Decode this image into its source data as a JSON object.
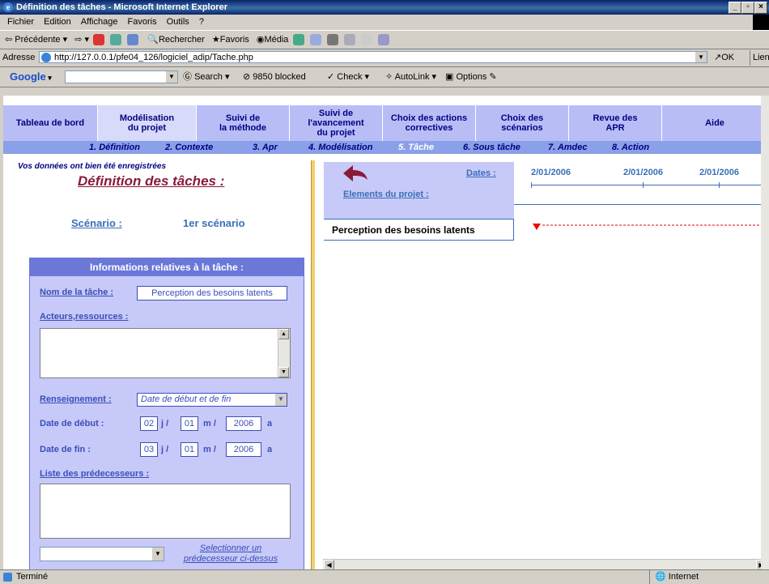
{
  "window": {
    "title": "Définition des tâches - Microsoft Internet Explorer"
  },
  "menu": [
    "Fichier",
    "Edition",
    "Affichage",
    "Favoris",
    "Outils",
    "?"
  ],
  "toolbar": {
    "back": "Précédente",
    "search": "Rechercher",
    "favorites": "Favoris",
    "media": "Média"
  },
  "address": {
    "label": "Adresse",
    "url": "http://127.0.0.1/pfe04_126/logiciel_adip/Tache.php",
    "go": "OK",
    "links": "Lien"
  },
  "google": {
    "logo": "Google",
    "search": "Search",
    "blocked": "9850 blocked",
    "check": "Check",
    "autolink": "AutoLink",
    "options": "Options"
  },
  "tabs": [
    {
      "label": "Tableau de bord"
    },
    {
      "label": "Modélisation\ndu projet"
    },
    {
      "label": "Suivi de\nla méthode"
    },
    {
      "label": "Suivi de\nl'avancement\ndu projet"
    },
    {
      "label": "Choix des actions\ncorrectives"
    },
    {
      "label": "Choix des\nscénarios"
    },
    {
      "label": "Revue des\nAPR"
    },
    {
      "label": "Aide"
    }
  ],
  "subnav": [
    "1. Définition",
    "2. Contexte",
    "3. Apr",
    "4. Modélisation",
    "5. Tâche",
    "6. Sous tâche",
    "7. Amdec",
    "8. Action"
  ],
  "saved_msg": "Vos données ont bien été enregistrées",
  "page_title": "Définition des tâches :",
  "scenario": {
    "label": "Scénario :",
    "value": "1er scénario"
  },
  "panel": {
    "header": "Informations relatives à la tâche :",
    "task_name_label": "Nom de la tâche :",
    "task_name_value": "Perception des besoins latents",
    "actors_label": "Acteurs,ressources :",
    "info_label": "Renseignement :",
    "info_value": "Date de début et de fin",
    "start_label": "Date de début :",
    "start": {
      "d": "02",
      "m": "01",
      "y": "2006"
    },
    "end_label": "Date de fin :",
    "end": {
      "d": "03",
      "m": "01",
      "y": "2006"
    },
    "sep_j": "j /",
    "sep_m": "m /",
    "sep_a": "a",
    "pred_label": "Liste des prédecesseurs :",
    "select_pred_line1": "Selectionner un",
    "select_pred_line2": "prédecesseur ci-dessus"
  },
  "timeline": {
    "dates_label": "Dates :",
    "elements_label": "Elements du projet :",
    "dates": [
      "2/01/2006",
      "2/01/2006",
      "2/01/2006"
    ],
    "task": "Perception des besoins latents"
  },
  "status": {
    "left": "Terminé",
    "zone": "Internet"
  }
}
